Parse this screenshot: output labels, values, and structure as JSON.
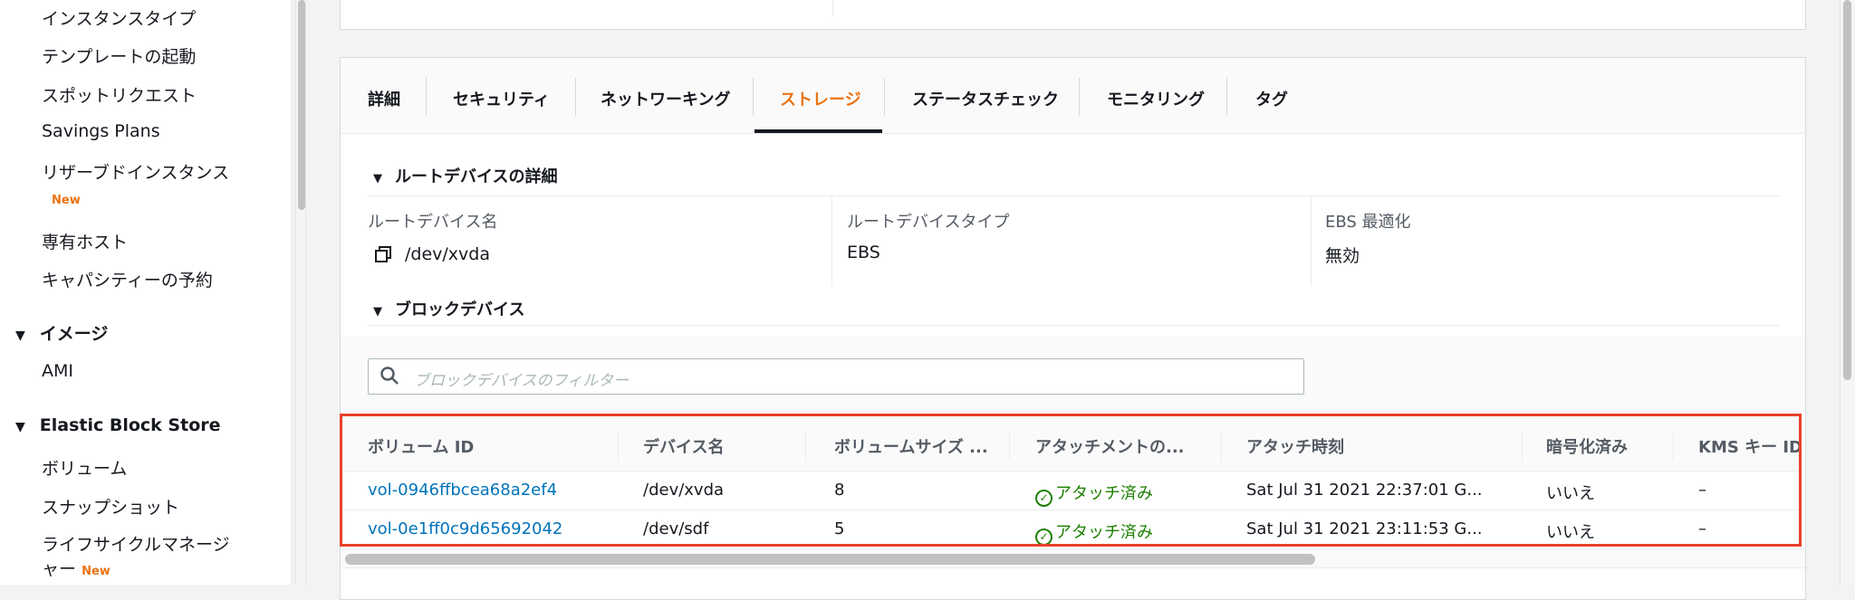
{
  "sidebar": {
    "items": [
      "インスタンスタイプ",
      "テンプレートの起動",
      "スポットリクエスト",
      "Savings Plans",
      "リザーブドインスタンス",
      "専有ホスト",
      "キャパシティーの予約"
    ],
    "new_badge": "New",
    "images_section": "イメージ",
    "images_items": [
      "AMI"
    ],
    "ebs_section": "Elastic Block Store",
    "ebs_items": [
      "ボリューム",
      "スナップショット",
      "ライフサイクルマネージ",
      "ャー"
    ]
  },
  "tabs": [
    "詳細",
    "セキュリティ",
    "ネットワーキング",
    "ストレージ",
    "ステータスチェック",
    "モニタリング",
    "タグ"
  ],
  "active_tab": "ストレージ",
  "root_device": {
    "section": "ルートデバイスの詳細",
    "name_label": "ルートデバイス名",
    "name_value": "/dev/xvda",
    "type_label": "ルートデバイスタイプ",
    "type_value": "EBS",
    "ebs_label": "EBS 最適化",
    "ebs_value": "無効"
  },
  "block_devices": {
    "section": "ブロックデバイス",
    "filter_placeholder": "ブロックデバイスのフィルター",
    "columns": [
      "ボリューム ID",
      "デバイス名",
      "ボリュームサイズ ...",
      "アタッチメントの...",
      "アタッチ時刻",
      "暗号化済み",
      "KMS キー ID"
    ],
    "rows": [
      [
        "vol-0946ffbcea68a2ef4",
        "/dev/xvda",
        "8",
        "アタッチ済み",
        "Sat Jul 31 2021 22:37:01 G...",
        "いいえ",
        "–"
      ],
      [
        "vol-0e1ff0c9d65692042",
        "/dev/sdf",
        "5",
        "アタッチ済み",
        "Sat Jul 31 2021 23:11:53 G...",
        "いいえ",
        "–"
      ]
    ]
  },
  "colors": {
    "accent": "#ec7211",
    "link": "#0073bb",
    "success": "#1d8102",
    "highlight": "#e8412c"
  }
}
